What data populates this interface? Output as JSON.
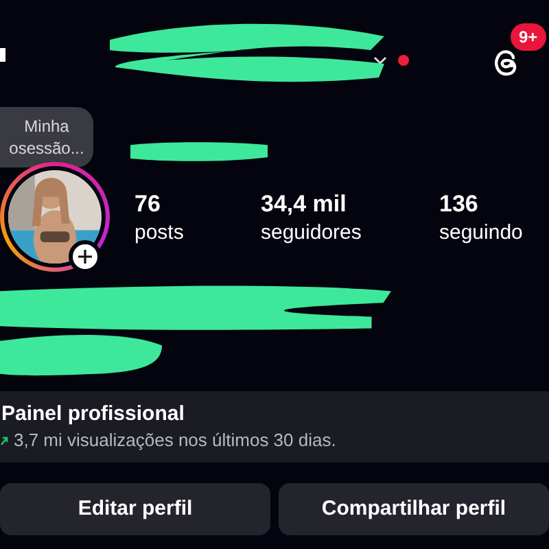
{
  "top_bar": {
    "notification_badge": "9+",
    "unread_dot": true
  },
  "note": {
    "lines": [
      "Minha",
      "osessão..."
    ]
  },
  "stats": [
    {
      "value": "76",
      "label": "posts"
    },
    {
      "value": "34,4 mil",
      "label": "seguidores"
    },
    {
      "value": "136",
      "label": "seguindo"
    }
  ],
  "dashboard": {
    "title": "Painel profissional",
    "summary": "3,7 mi visualizações nos últimos 30 dias."
  },
  "buttons": [
    "Editar perfil",
    "Compartilhar perfil"
  ]
}
